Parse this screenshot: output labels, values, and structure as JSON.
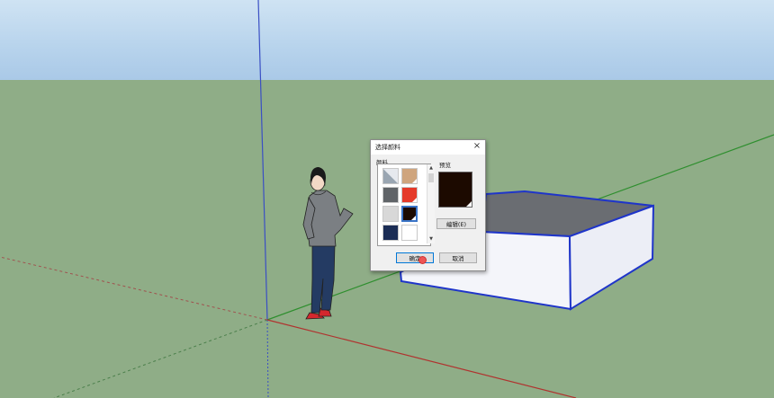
{
  "dialog": {
    "title": "选择颜料",
    "palette_label": "颜料",
    "preview_label": "预览",
    "edit_button": "编辑(E)",
    "ok_button": "确定",
    "cancel_button": "取消",
    "close_icon": "×"
  },
  "swatches": [
    {
      "name": "default-material",
      "color": "#9aa6b2"
    },
    {
      "name": "tan",
      "color": "#cfa57e"
    },
    {
      "name": "gray",
      "color": "#606468"
    },
    {
      "name": "red",
      "color": "#e53a2a"
    },
    {
      "name": "light-gray",
      "color": "#d8d8d8"
    },
    {
      "name": "dark-brown",
      "color": "#1c0a00",
      "selected": true
    },
    {
      "name": "navy",
      "color": "#1b2d55"
    },
    {
      "name": "white",
      "color": "#ffffff"
    }
  ],
  "colors": {
    "sky": "#b7d3ec",
    "ground": "#8fad87",
    "box_edges": "#1f35c9",
    "selected_swatch_border": "#3a74c7"
  }
}
